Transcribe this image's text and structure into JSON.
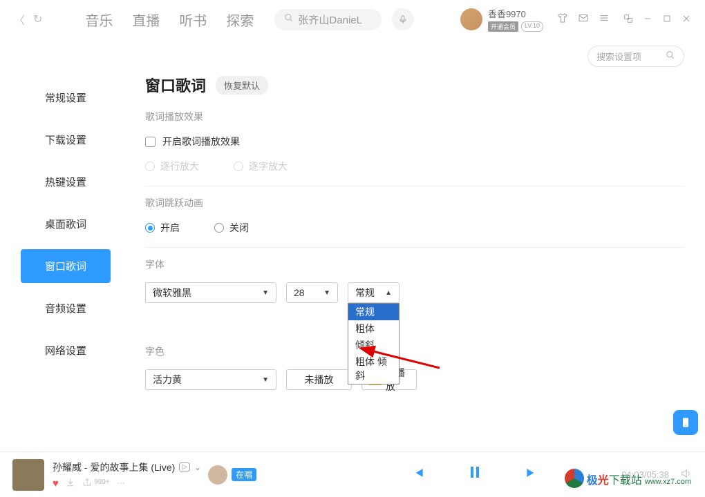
{
  "header": {
    "nav": [
      "音乐",
      "直播",
      "听书",
      "探索"
    ],
    "search_placeholder": "张齐山DanieL",
    "user": {
      "name": "香香9970",
      "vip_label": "开通会员",
      "level": "LV.10"
    }
  },
  "search_settings_placeholder": "搜索设置项",
  "sidebar": {
    "items": [
      "常规设置",
      "下载设置",
      "热键设置",
      "桌面歌词",
      "窗口歌词",
      "音频设置",
      "网络设置"
    ],
    "active_index": 4
  },
  "content": {
    "title": "窗口歌词",
    "reset_label": "恢复默认",
    "group_play_effect": "歌词播放效果",
    "checkbox_enable_effect": "开启歌词播放效果",
    "radio_line_zoom": "逐行放大",
    "radio_char_zoom": "逐字放大",
    "group_jump_anim": "歌词跳跃动画",
    "radio_on": "开启",
    "radio_off": "关闭",
    "group_font": "字体",
    "font_family": "微软雅黑",
    "font_size": "28",
    "font_style": "常规",
    "font_style_options": [
      "常规",
      "粗体",
      "倾斜",
      "粗体 倾斜"
    ],
    "group_color": "字色",
    "color_name": "活力黄",
    "color_notplayed_label": "未播放",
    "color_played_label": "已播放"
  },
  "player": {
    "track_title": "孙耀威 - 爱的故事上集 (Live)",
    "singer_badge": "在唱",
    "share_count": "999+",
    "time": "04:03/05:38"
  },
  "watermark": {
    "text1": "极",
    "text2": "光",
    "text3": "下载站",
    "site": "www.xz7.com"
  }
}
